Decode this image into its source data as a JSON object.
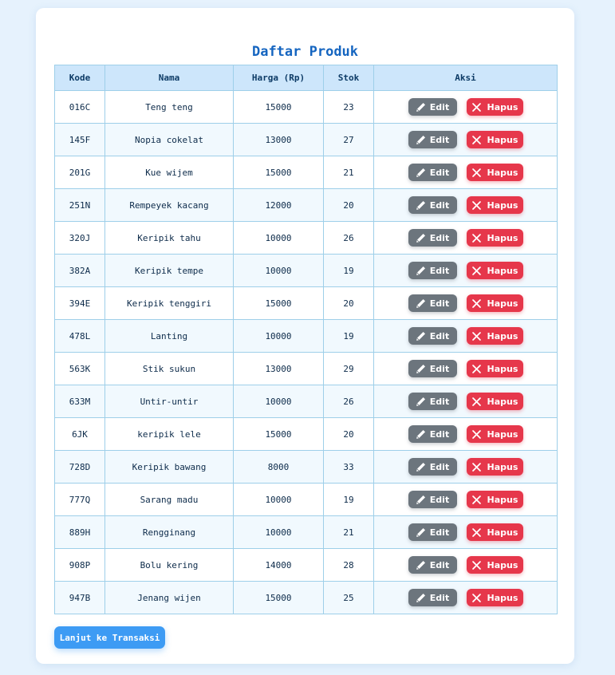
{
  "page": {
    "title": "Daftar Produk"
  },
  "table": {
    "headers": {
      "code": "Kode",
      "name": "Nama",
      "price": "Harga (Rp)",
      "stock": "Stok",
      "actions": "Aksi"
    },
    "edit_label": "Edit",
    "delete_label": "Hapus",
    "rows": [
      {
        "code": "016C",
        "name": "Teng teng",
        "price": "15000",
        "stock": "23"
      },
      {
        "code": "145F",
        "name": "Nopia cokelat",
        "price": "13000",
        "stock": "27"
      },
      {
        "code": "201G",
        "name": "Kue wijem",
        "price": "15000",
        "stock": "21"
      },
      {
        "code": "251N",
        "name": "Rempeyek kacang",
        "price": "12000",
        "stock": "20"
      },
      {
        "code": "320J",
        "name": "Keripik tahu",
        "price": "10000",
        "stock": "26"
      },
      {
        "code": "382A",
        "name": "Keripik tempe",
        "price": "10000",
        "stock": "19"
      },
      {
        "code": "394E",
        "name": "Keripik tenggiri",
        "price": "15000",
        "stock": "20"
      },
      {
        "code": "478L",
        "name": "Lanting",
        "price": "10000",
        "stock": "19"
      },
      {
        "code": "563K",
        "name": "Stik sukun",
        "price": "13000",
        "stock": "29"
      },
      {
        "code": "633M",
        "name": "Untir-untir",
        "price": "10000",
        "stock": "26"
      },
      {
        "code": "6JK",
        "name": "keripik lele",
        "price": "15000",
        "stock": "20"
      },
      {
        "code": "728D",
        "name": "Keripik bawang",
        "price": "8000",
        "stock": "33"
      },
      {
        "code": "777Q",
        "name": "Sarang madu",
        "price": "10000",
        "stock": "19"
      },
      {
        "code": "889H",
        "name": "Rengginang",
        "price": "10000",
        "stock": "21"
      },
      {
        "code": "908P",
        "name": "Bolu kering",
        "price": "14000",
        "stock": "28"
      },
      {
        "code": "947B",
        "name": "Jenang wijen",
        "price": "15000",
        "stock": "25"
      }
    ]
  },
  "footer": {
    "next_label": "Lanjut ke Transaksi"
  },
  "colors": {
    "background": "#e6f2fd",
    "title": "#1565c0",
    "header_bg": "#cde6fb",
    "edit_button": "#6c757d",
    "delete_button": "#e6374b",
    "primary_button": "#3d9bf4"
  },
  "icons": {
    "edit": "pencil-icon",
    "delete": "x-icon"
  }
}
